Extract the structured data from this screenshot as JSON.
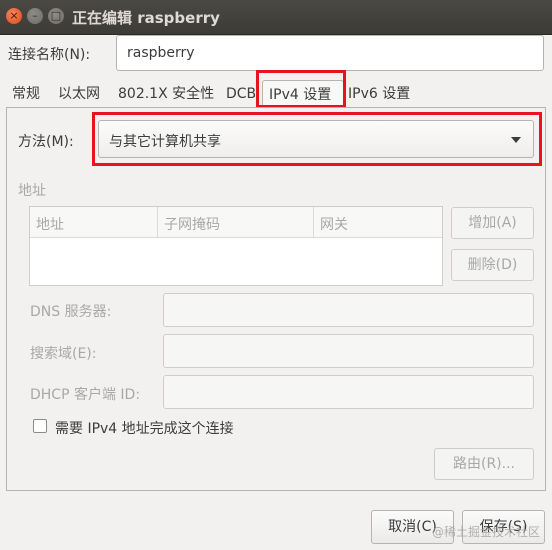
{
  "window": {
    "title": "正在编辑 raspberry",
    "close": "×",
    "minimize": "–",
    "maximize": "□"
  },
  "connection": {
    "name_label": "连接名称(N):",
    "name_value": "raspberry"
  },
  "tabs": [
    {
      "label": "常规"
    },
    {
      "label": "以太网"
    },
    {
      "label": "802.1X 安全性"
    },
    {
      "label": "DCB"
    },
    {
      "label": "IPv4 设置"
    },
    {
      "label": "IPv6 设置"
    }
  ],
  "ipv4": {
    "method_label": "方法(M):",
    "method_value": "与其它计算机共享",
    "addresses_heading": "地址",
    "columns": [
      "地址",
      "子网掩码",
      "网关"
    ],
    "add_button": "增加(A)",
    "delete_button": "删除(D)",
    "dns_label": "DNS 服务器:",
    "search_domains_label": "搜索域(E):",
    "dhcp_client_id_label": "DHCP 客户端 ID:",
    "require_checkbox_label": "需要 IPv4 地址完成这个连接",
    "routes_button": "路由(R)..."
  },
  "footer": {
    "cancel": "取消(C)",
    "save": "保存(S)"
  },
  "watermark": "@稀土掘金技术社区",
  "colors": {
    "highlight": "#e8131c",
    "titlebar": "#3c3b37"
  }
}
